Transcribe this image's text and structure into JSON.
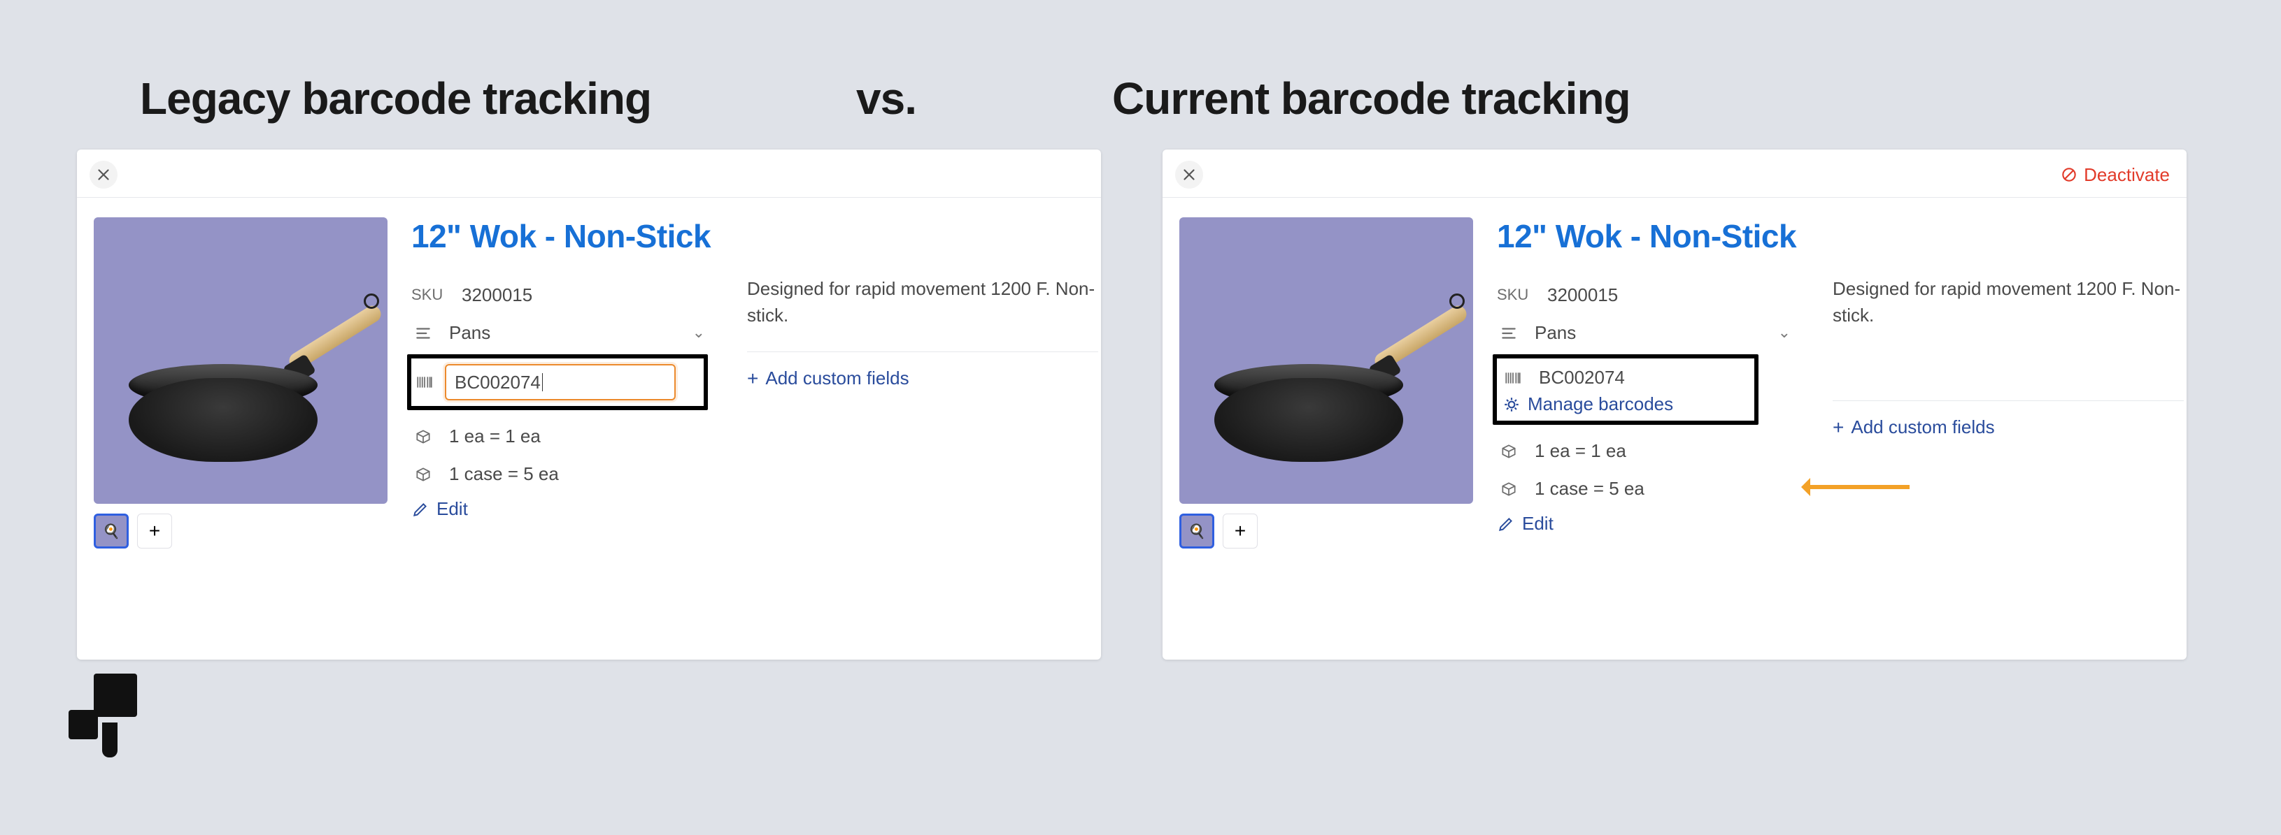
{
  "headings": {
    "legacy": "Legacy barcode tracking",
    "vs": "vs.",
    "current": "Current barcode tracking"
  },
  "deactivate_label": "Deactivate",
  "product": {
    "title": "12\" Wok - Non-Stick",
    "sku_label": "SKU",
    "sku_value": "3200015",
    "category": "Pans",
    "barcode": "BC002074",
    "uom1": "1 ea = 1 ea",
    "uom2": "1 case = 5 ea",
    "edit": "Edit",
    "description": "Designed for rapid movement 1200 F. Non-stick.",
    "add_custom": "Add custom fields",
    "add_thumb": "+",
    "manage_barcodes": "Manage barcodes"
  }
}
